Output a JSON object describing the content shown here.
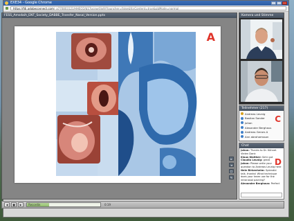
{
  "window": {
    "title": "EXE34 - Google Chrome"
  },
  "address_bar": {
    "domain": "https://fdi.adobeconnect.com",
    "path": "/_a770803121/HHECO/b17pcswr0jx9/?launcher=false&fcsContent=true&pbMode=normal"
  },
  "share_pod": {
    "title": "FESS_Amsdaih_ENT_Society_DABBE_Transfer_Nasal_Version.pptx",
    "letter": "A",
    "slide_progress": 0.63
  },
  "camera_pod": {
    "title": "Kamera und Stimme"
  },
  "attendees_pod": {
    "title": "Teilnehmer (217)",
    "letter": "C",
    "items": [
      {
        "name": "Andreas Leunig",
        "color": "#d9a11e"
      },
      {
        "name": "Bastian Sander",
        "color": "#3f7fc8"
      },
      {
        "name": "Johan",
        "color": "#3f7fc8"
      },
      {
        "name": "Alexander Berghaus",
        "color": "#3f7fc8"
      },
      {
        "name": "Andreas Gerars A",
        "color": "#3f7fc8"
      },
      {
        "name": "Ann abrahamsson",
        "color": "#3f7fc8"
      }
    ]
  },
  "chat_pod": {
    "title": "Chat",
    "letter": "D",
    "messages": [
      {
        "who": "Johan:",
        "text": "Thanks to Dr. Kühnel. Vielen Dank"
      },
      {
        "who": "Klaus Walther:",
        "text": "Sehr gut"
      },
      {
        "who": "Claudia Leunig:",
        "text": "great"
      },
      {
        "who": "Johan:",
        "text": "Please write your question to Andreas Leunig here"
      },
      {
        "who": "Nele Birkenheim:",
        "text": "Splendid talk, thanks! What technique does your team use for the intranasal packing?"
      },
      {
        "who": "Alexander Berghaus:",
        "text": "Perfect"
      }
    ]
  },
  "bottom_bar": {
    "buttons": [
      "◀",
      "■",
      "▶"
    ],
    "timeline_label": "Recordin",
    "timeline_progress": 0.3,
    "time_label": "0:19"
  },
  "colors": {
    "accent_letter": "#e0352b",
    "titlebar": "#2c5da4"
  }
}
